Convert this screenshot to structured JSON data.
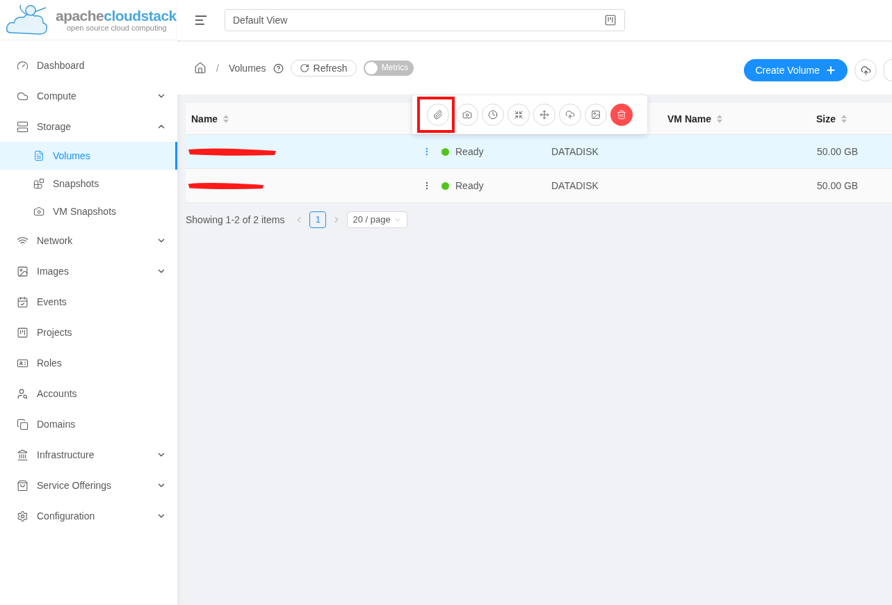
{
  "logo": {
    "name_part1": "apache",
    "name_part2": "cloudstack",
    "tagline": "open source cloud computing"
  },
  "header": {
    "view": "Default View"
  },
  "sidebar": {
    "items": [
      {
        "label": "Dashboard",
        "kind": "link",
        "selected": false
      },
      {
        "label": "Compute",
        "kind": "group",
        "expanded": false
      },
      {
        "label": "Storage",
        "kind": "group",
        "expanded": true,
        "children": [
          {
            "label": "Volumes",
            "selected": true
          },
          {
            "label": "Snapshots",
            "selected": false
          },
          {
            "label": "VM Snapshots",
            "selected": false
          }
        ]
      },
      {
        "label": "Network",
        "kind": "group",
        "expanded": false
      },
      {
        "label": "Images",
        "kind": "group",
        "expanded": false
      },
      {
        "label": "Events",
        "kind": "link",
        "selected": false
      },
      {
        "label": "Projects",
        "kind": "link",
        "selected": false
      },
      {
        "label": "Roles",
        "kind": "link",
        "selected": false
      },
      {
        "label": "Accounts",
        "kind": "link",
        "selected": false
      },
      {
        "label": "Domains",
        "kind": "link",
        "selected": false
      },
      {
        "label": "Infrastructure",
        "kind": "group",
        "expanded": false
      },
      {
        "label": "Service Offerings",
        "kind": "group",
        "expanded": false
      },
      {
        "label": "Configuration",
        "kind": "group",
        "expanded": false
      }
    ]
  },
  "toolbar": {
    "separator": "/",
    "breadcrumb": "Volumes",
    "refresh": "Refresh",
    "metrics": {
      "label": "Metrics",
      "on": false
    },
    "create": "Create Volume"
  },
  "actions": [
    {
      "kind": "default",
      "highlighted": true
    },
    {
      "kind": "default",
      "highlighted": false
    },
    {
      "kind": "default",
      "highlighted": false
    },
    {
      "kind": "default",
      "highlighted": false
    },
    {
      "kind": "default",
      "highlighted": false
    },
    {
      "kind": "default",
      "highlighted": false
    },
    {
      "kind": "default",
      "highlighted": false
    },
    {
      "kind": "danger",
      "highlighted": false
    }
  ],
  "table": {
    "columns": [
      "Name",
      "VM Name",
      "Size"
    ],
    "rows": [
      {
        "selected": true,
        "status": "Ready",
        "color": "#52c41a",
        "type": "DATADISK",
        "size": "50.00 GB"
      },
      {
        "selected": false,
        "status": "Ready",
        "color": "#52c41a",
        "type": "DATADISK",
        "size": "50.00 GB"
      }
    ]
  },
  "pagination": {
    "summary": "Showing 1-2 of 2 items",
    "page": "1",
    "page_size": "20 / page"
  }
}
